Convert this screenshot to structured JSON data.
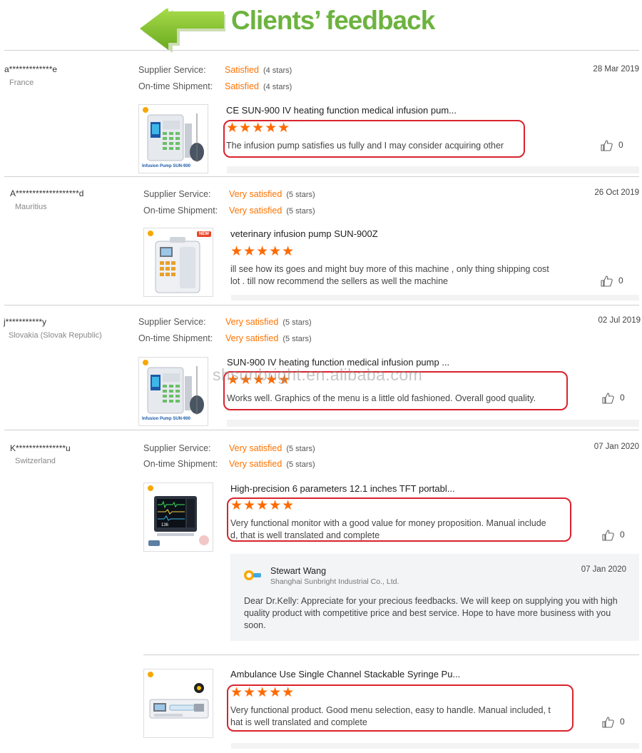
{
  "banner": {
    "title": "Clients’ feedback"
  },
  "labels": {
    "supplier": "Supplier Service:",
    "shipment": "On-time Shipment:"
  },
  "watermark": "shsunbright.en.alibaba.com",
  "entries": [
    {
      "buyer": "a*************e",
      "country": "France",
      "date": "28 Mar 2019",
      "supplier_rating": "Satisfied",
      "supplier_stars": "(4 stars)",
      "shipment_rating": "Satisfied",
      "shipment_stars": "(4 stars)",
      "product_title": "CE SUN-900 IV heating function medical infusion pum...",
      "stars": "★★★★★",
      "review": "The infusion pump satisfies us fully and I may consider acquiring other",
      "likes": "0",
      "thumb_caption": "Infusion Pump SUN-900"
    },
    {
      "buyer": "A*******************d",
      "country": "Mauritius",
      "date": "26 Oct 2019",
      "supplier_rating": "Very satisfied",
      "supplier_stars": "(5 stars)",
      "shipment_rating": "Very satisfied",
      "shipment_stars": "(5 stars)",
      "product_title": "veterinary infusion pump SUN-900Z",
      "stars": "★★★★★",
      "review_line1": "ill see how its goes and might buy more of this machine , only thing shipping cost",
      "review_line2": "lot . till now recommend the sellers as well the machine",
      "likes": "0",
      "thumb_badge": "NEW"
    },
    {
      "buyer": "j***********y",
      "country": "Slovakia (Slovak Republic)",
      "date": "02 Jul 2019",
      "supplier_rating": "Very satisfied",
      "supplier_stars": "(5 stars)",
      "shipment_rating": "Very satisfied",
      "shipment_stars": "(5 stars)",
      "product_title": "SUN-900 IV heating function medical infusion pump ...",
      "stars": "★★★★★",
      "review": "Works well. Graphics of the menu is a little old fashioned. Overall good quality.",
      "likes": "0",
      "thumb_caption": "Infusion Pump SUN-900"
    },
    {
      "buyer": "K***************u",
      "country": "Switzerland",
      "date": "07 Jan 2020",
      "supplier_rating": "Very satisfied",
      "supplier_stars": "(5 stars)",
      "shipment_rating": "Very satisfied",
      "shipment_stars": "(5 stars)",
      "product_title": "High-precision 6 parameters 12.1 inches TFT portabl...",
      "stars": "★★★★★",
      "review_line1": "Very functional monitor with a good value for money proposition. Manual include",
      "review_line2": "d, that is well translated and complete",
      "likes": "0",
      "reply": {
        "name": "Stewart Wang",
        "company": "Shanghai Sunbright Industrial Co., Ltd.",
        "date": "07 Jan 2020",
        "line1": "Dear Dr.Kelly: Appreciate for your precious feedbacks. We will keep on supplying you with high",
        "line2": "quality product with competitive price and best service. Hope to have more business with you",
        "line3": "soon."
      }
    },
    {
      "product_title": "Ambulance Use Single Channel Stackable Syringe Pu...",
      "stars": "★★★★★",
      "review_line1": "Very functional product. Good menu selection, easy to handle. Manual included, t",
      "review_line2": "hat is well translated and complete",
      "likes": "0"
    }
  ]
}
